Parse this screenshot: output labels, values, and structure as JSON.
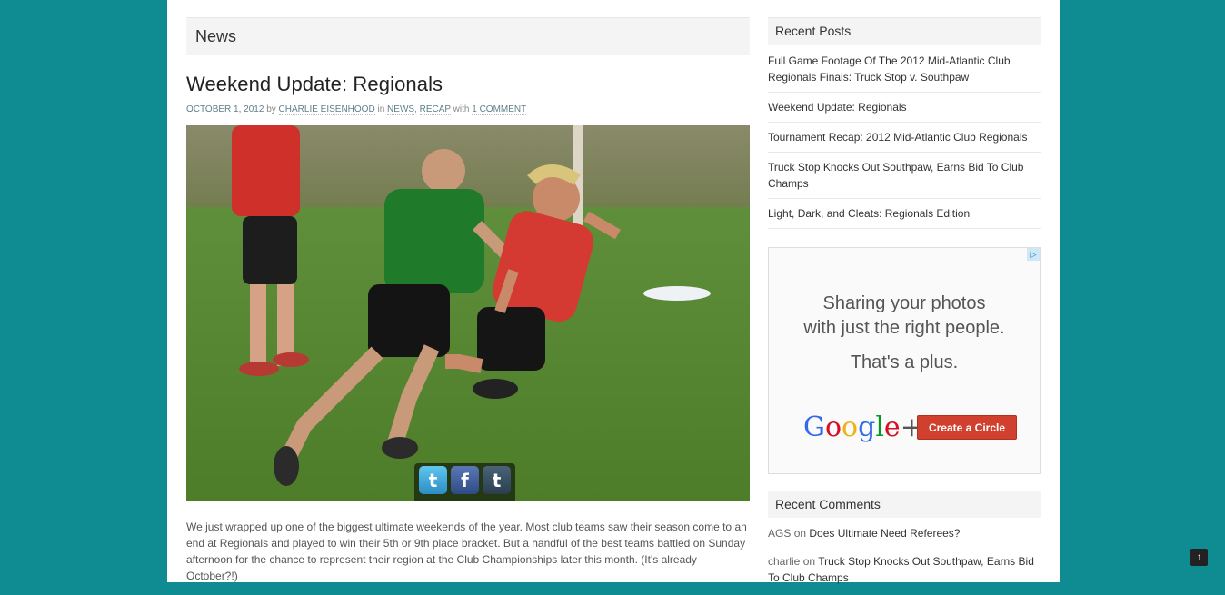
{
  "main": {
    "section_title": "News",
    "post": {
      "title": "Weekend Update: Regionals",
      "date": "OCTOBER 1, 2012",
      "by": "by",
      "author": "CHARLIE EISENHOOD",
      "in": "in",
      "category1": "NEWS",
      "category2": "RECAP",
      "with": "with",
      "comments_link": "1 COMMENT",
      "body": "We just wrapped up one of the biggest ultimate weekends of the year. Most club teams saw their season come to an end at Regionals and played to win their 5th or 9th place bracket. But a handful of the best teams battled on Sunday afternoon for the chance to represent their region at the Club Championships later this month. (It's already October?!)"
    },
    "share": {
      "twitter_glyph": "t",
      "facebook_glyph": "f",
      "tumblr_glyph": "t"
    }
  },
  "sidebar": {
    "recent_posts_title": "Recent Posts",
    "recent_posts": [
      "Full Game Footage Of The 2012 Mid-Atlantic Club Regionals Finals: Truck Stop v. Southpaw",
      "Weekend Update: Regionals",
      "Tournament Recap: 2012 Mid-Atlantic Club Regionals",
      "Truck Stop Knocks Out Southpaw, Earns Bid To Club Champs",
      "Light, Dark, and Cleats: Regionals Edition"
    ],
    "ad": {
      "line1": "Sharing your photos",
      "line2": "with just the right people.",
      "line3": "That's a plus.",
      "logo_text": "Google+",
      "button": "Create a Circle",
      "adchoices_glyph": "▷"
    },
    "recent_comments_title": "Recent Comments",
    "recent_comments": [
      {
        "author": "AGS",
        "on": "on",
        "post": "Does Ultimate Need Referees?"
      },
      {
        "author": "charlie",
        "on": "on",
        "post": "Truck Stop Knocks Out Southpaw, Earns Bid To Club Champs"
      }
    ]
  },
  "back_to_top_glyph": "↑",
  "colors": {
    "background": "#0f8c92",
    "link": "#5d7f8a",
    "ad_button": "#d1402e"
  }
}
